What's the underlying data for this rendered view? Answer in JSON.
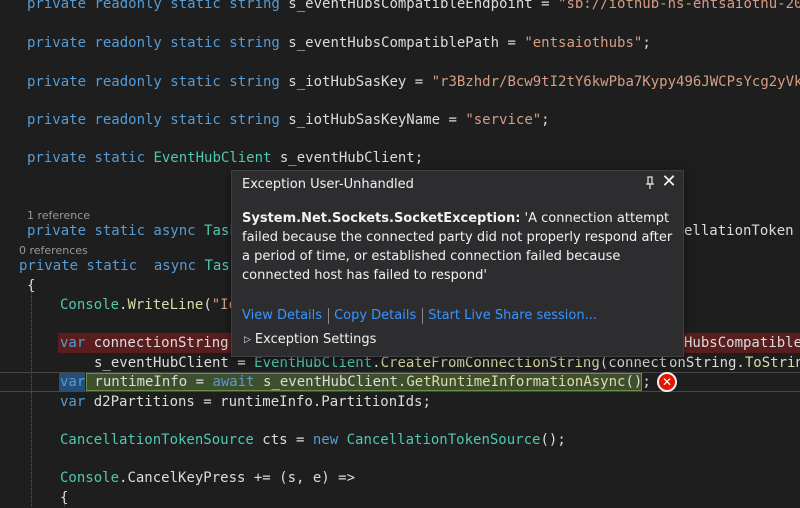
{
  "code_lines": [
    {
      "parts": [
        {
          "t": "private readonly static string ",
          "c": "kw"
        },
        {
          "t": "s_eventHubsCompatibleEndpoint = ",
          "c": "pl"
        },
        {
          "t": "\"sb://iothub-ns-entsaiothu-208",
          "c": "st"
        }
      ]
    },
    {
      "parts": [
        {
          "t": "private readonly static string ",
          "c": "kw"
        },
        {
          "t": "s_eventHubsCompatiblePath = ",
          "c": "pl"
        },
        {
          "t": "\"entsaiothubs\"",
          "c": "st"
        },
        {
          "t": ";",
          "c": "pl"
        }
      ]
    },
    {
      "parts": [
        {
          "t": "private readonly static string ",
          "c": "kw"
        },
        {
          "t": "s_iotHubSasKey = ",
          "c": "pl"
        },
        {
          "t": "\"r3Bzhdr/Bcw9tI2tY6kwPba7Kypy496JWCPsYcg2yVk=",
          "c": "st"
        }
      ]
    },
    {
      "parts": [
        {
          "t": "private readonly static string ",
          "c": "kw"
        },
        {
          "t": "s_iotHubSasKeyName = ",
          "c": "pl"
        },
        {
          "t": "\"service\"",
          "c": "st"
        },
        {
          "t": ";",
          "c": "pl"
        }
      ]
    },
    {
      "parts": [
        {
          "t": "private static ",
          "c": "kw"
        },
        {
          "t": "EventHubClient ",
          "c": "ty"
        },
        {
          "t": "s_eventHubClient;",
          "c": "pl"
        }
      ]
    },
    {
      "parts": [
        {
          "t": "private static async ",
          "c": "kw"
        },
        {
          "t": "Task",
          "c": "ty"
        }
      ]
    },
    {
      "parts": [
        {
          "t": "ellationToken ",
          "c": "pl"
        }
      ]
    },
    {
      "parts": [
        {
          "t": "private static  async ",
          "c": "kw"
        },
        {
          "t": "Task",
          "c": "ty"
        }
      ]
    },
    {
      "parts": [
        {
          "t": "{",
          "c": "pl"
        }
      ]
    },
    {
      "parts": [
        {
          "t": "Console",
          "c": "ty"
        },
        {
          "t": ".",
          "c": "pl"
        },
        {
          "t": "WriteLine",
          "c": "fn"
        },
        {
          "t": "(",
          "c": "pl"
        },
        {
          "t": "\"Io",
          "c": "st"
        }
      ]
    },
    {
      "parts": [
        {
          "t": "var ",
          "c": "kw"
        },
        {
          "t": "connectionString",
          "c": "pl"
        }
      ]
    },
    {
      "parts": [
        {
          "t": "HubsCompatible",
          "c": "pl"
        }
      ]
    },
    {
      "parts": [
        {
          "t": "s_eventHubClient = ",
          "c": "pl"
        },
        {
          "t": "EventHubClient",
          "c": "ty"
        },
        {
          "t": ".",
          "c": "pl"
        },
        {
          "t": "CreateFromConnectionString",
          "c": "fn"
        },
        {
          "t": "(connect",
          "c": "pl"
        }
      ]
    },
    {
      "parts": [
        {
          "t": "onString.",
          "c": "pl"
        },
        {
          "t": "ToStrin",
          "c": "fn"
        }
      ]
    },
    {
      "parts": [
        {
          "t": "var",
          "c": "kw"
        }
      ]
    },
    {
      "parts": [
        {
          "t": " runtimeInfo = ",
          "c": "pl"
        },
        {
          "t": "await ",
          "c": "kw"
        },
        {
          "t": "s_eventHubClient.",
          "c": "pl"
        },
        {
          "t": "GetRuntimeInformationAsync",
          "c": "fn"
        },
        {
          "t": "();",
          "c": "pl"
        }
      ]
    },
    {
      "parts": [
        {
          "t": "var ",
          "c": "kw"
        },
        {
          "t": "d2Partitions = runtimeInfo.PartitionIds;",
          "c": "pl"
        }
      ]
    },
    {
      "parts": [
        {
          "t": "CancellationTokenSource ",
          "c": "ty"
        },
        {
          "t": "cts = ",
          "c": "pl"
        },
        {
          "t": "new ",
          "c": "kw"
        },
        {
          "t": "CancellationTokenSource",
          "c": "ty"
        },
        {
          "t": "();",
          "c": "pl"
        }
      ]
    },
    {
      "parts": [
        {
          "t": "Console",
          "c": "ty"
        },
        {
          "t": ".CancelKeyPress += (s, e) =>",
          "c": "pl"
        }
      ]
    },
    {
      "parts": [
        {
          "t": "{",
          "c": "pl"
        }
      ]
    }
  ],
  "references": {
    "first": "1 reference",
    "second": "0 references"
  },
  "popup": {
    "title": "Exception User-Unhandled",
    "exception_type": "System.Net.Sockets.SocketException:",
    "message": " 'A connection attempt failed because the connected party did not properly respond after a period of time, or established connection failed because connected host has failed to respond'",
    "link_view_details": "View Details",
    "link_copy_details": "Copy Details",
    "link_live_share": "Start Live Share session...",
    "exception_settings": "Exception Settings"
  },
  "icons": {
    "pin": "pin-icon",
    "close": "close-icon",
    "error": "error-icon",
    "expand": "expand-triangle-icon"
  },
  "colors": {
    "keyword": "#569cd6",
    "type": "#4ec9b0",
    "string": "#d69d85",
    "method": "#dcdcaa",
    "error_line": "#5a1d1d",
    "link": "#3794ff"
  }
}
